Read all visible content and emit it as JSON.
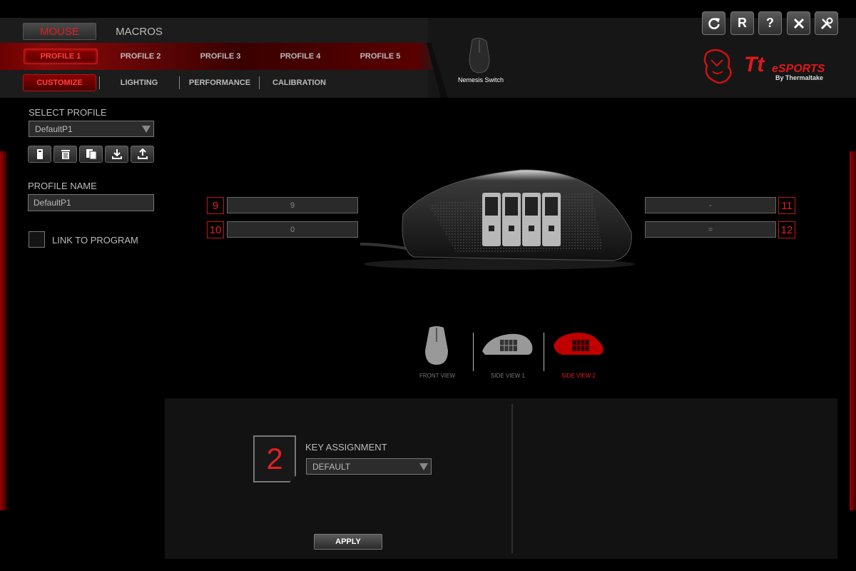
{
  "main_tabs": {
    "mouse": "MOUSE",
    "macros": "MACROS"
  },
  "profiles": [
    "PROFILE 1",
    "PROFILE 2",
    "PROFILE 3",
    "PROFILE 4",
    "PROFILE 5"
  ],
  "sub_tabs": {
    "customize": "CUSTOMIZE",
    "lighting": "LIGHTING",
    "performance": "PERFORMANCE",
    "calibration": "CALIBRATION"
  },
  "toolbar": {
    "refresh_icon": "refresh-icon",
    "reset_label": "R",
    "help_label": "?",
    "close_icon": "close-icon",
    "settings_icon": "tools-icon"
  },
  "device": {
    "name": "Nemesis Switch"
  },
  "brand": {
    "logo_text": "Tt eSPORTS",
    "sub_text": "By Thermaltake",
    "accent": "#e02020"
  },
  "left_panel": {
    "select_profile_label": "SELECT PROFILE",
    "selected_profile": "DefaultP1",
    "profile_name_label": "PROFILE NAME",
    "profile_name_value": "DefaultP1",
    "link_to_program_label": "LINK TO PROGRAM",
    "profile_actions": [
      "new-profile-icon",
      "delete-icon",
      "copy-icon",
      "import-icon",
      "export-icon"
    ]
  },
  "buttons": {
    "b9": {
      "num": "9",
      "value": "9"
    },
    "b10": {
      "num": "10",
      "value": "0"
    },
    "b11": {
      "num": "11",
      "value": "-"
    },
    "b12": {
      "num": "12",
      "value": "="
    }
  },
  "views": {
    "front": "FRONT VIEW",
    "side1": "SIDE VIEW 1",
    "side2": "SIDE VIEW 2",
    "active": "SIDE VIEW 2"
  },
  "key_assignment": {
    "key_number": "2",
    "label": "KEY ASSIGNMENT",
    "value": "DEFAULT",
    "apply_label": "APPLY"
  }
}
